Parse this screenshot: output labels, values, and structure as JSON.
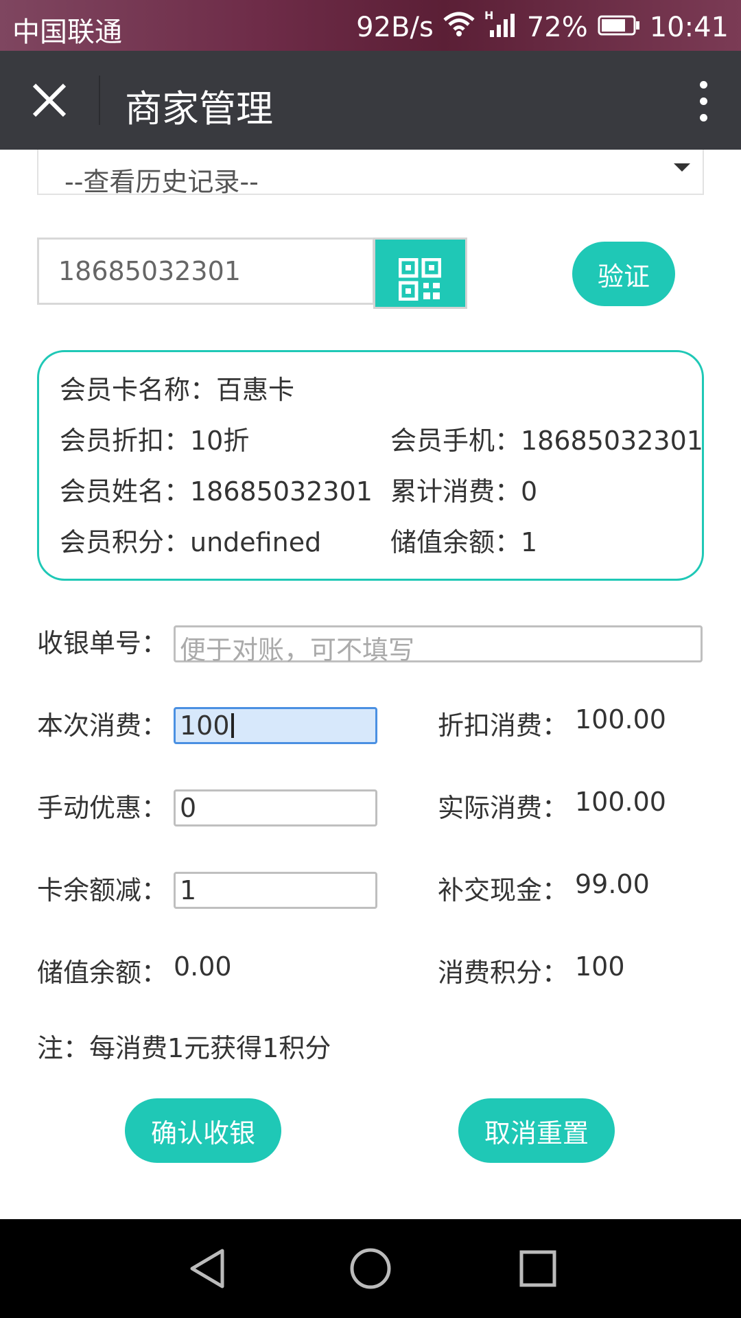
{
  "status_bar": {
    "carrier": "中国联通",
    "net_speed": "92B/s",
    "signal_type": "H",
    "battery": "72%",
    "time": "10:41"
  },
  "app_bar": {
    "title": "商家管理",
    "close_icon": "close-icon",
    "more_icon": "more-vertical-icon"
  },
  "history": {
    "selected": "--查看历史记录--"
  },
  "phone_search": {
    "value": "18685032301",
    "qr_icon": "qr-code-icon",
    "verify_label": "验证"
  },
  "member_card": {
    "card_name": "会员卡名称：百惠卡",
    "discount": "会员折扣：10折",
    "phone": "会员手机：18685032301",
    "name": "会员姓名：18685032301",
    "total_spend": "累计消费：0",
    "points": "会员积分：undefined",
    "stored_balance": "储值余额：1"
  },
  "form": {
    "receipt_label": "收银单号：",
    "receipt_placeholder": "便于对账，可不填写",
    "amount_label": "本次消费：",
    "amount_value": "100",
    "discounted_label": "折扣消费：",
    "discounted_value": "100.00",
    "manual_discount_label": "手动优惠：",
    "manual_discount_value": "0",
    "actual_label": "实际消费：",
    "actual_value": "100.00",
    "card_deduct_label": "卡余额减：",
    "card_deduct_value": "1",
    "cash_label": "补交现金：",
    "cash_value": "99.00",
    "balance_label": "储值余额：",
    "balance_value": "0.00",
    "earn_points_label": "消费积分：",
    "earn_points_value": "100"
  },
  "note": "注：每消费1元获得1积分",
  "actions": {
    "confirm_label": "确认收银",
    "reset_label": "取消重置"
  },
  "nav_bar": {
    "back_icon": "back-triangle-icon",
    "home_icon": "home-circle-icon",
    "recents_icon": "recents-square-icon"
  },
  "colors": {
    "accent": "#1fc8b6",
    "app_bar": "#393a3f"
  }
}
